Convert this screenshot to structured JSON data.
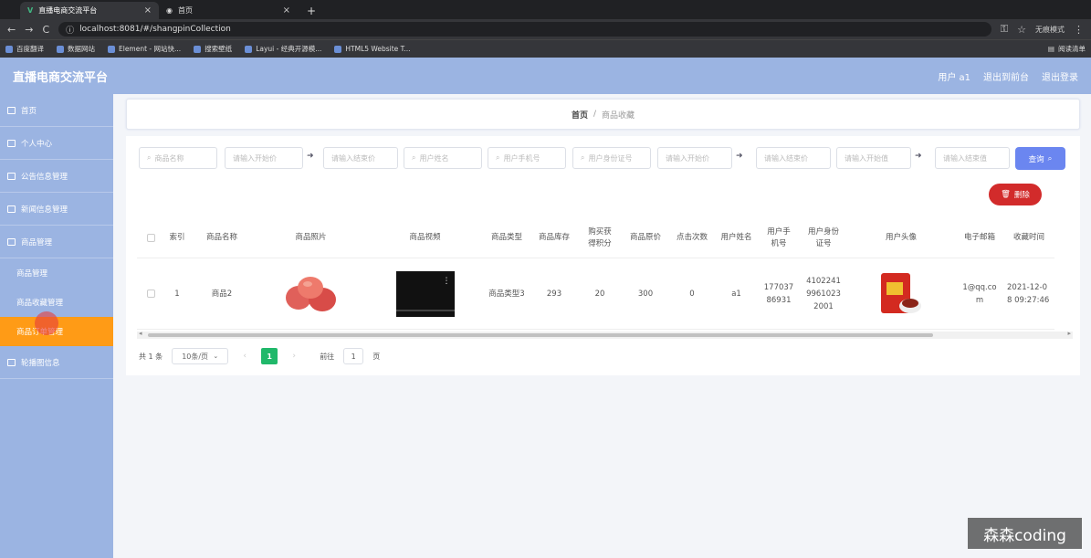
{
  "browser": {
    "tabs": [
      {
        "label": "直播电商交流平台"
      },
      {
        "label": "首页"
      }
    ],
    "url": "localhost:8081/#/shangpinCollection",
    "profile": "无痕模式",
    "reading_list": "阅读清单",
    "bookmarks": [
      "百度翻译",
      "数据网站",
      "Element - 网站快...",
      "搜索壁纸",
      "Layui - 经典开源模...",
      "HTML5 Website T..."
    ]
  },
  "header": {
    "brand": "直播电商交流平台",
    "user": "用户 a1",
    "back": "退出到前台",
    "logout": "退出登录"
  },
  "sidebar": {
    "items": [
      {
        "label": "首页"
      },
      {
        "label": "个人中心"
      },
      {
        "label": "公告信息管理"
      },
      {
        "label": "新闻信息管理"
      },
      {
        "label": "商品管理"
      }
    ],
    "subitems": [
      {
        "label": "商品管理"
      },
      {
        "label": "商品收藏管理"
      },
      {
        "label": "商品订单管理"
      }
    ],
    "extra": {
      "label": "轮播图信息"
    }
  },
  "breadcrumb": {
    "home": "首页",
    "sep": "/",
    "current": "商品收藏"
  },
  "filters": {
    "name": "商品名称",
    "start1": "请输入开始价",
    "end1": "请输入结束价",
    "username": "用户姓名",
    "phone": "用户手机号",
    "idcard": "用户身份证号",
    "start2": "请输入开始价",
    "end2": "请输入结束价",
    "start3": "请输入开始值",
    "end3": "请输入结束值",
    "query": "查询",
    "delete": "删除"
  },
  "table": {
    "headers": [
      "",
      "索引",
      "商品名称",
      "商品照片",
      "商品视频",
      "商品类型",
      "商品库存",
      "购买获得积分",
      "商品原价",
      "点击次数",
      "用户姓名",
      "用户手机号",
      "用户身份证号",
      "用户头像",
      "电子邮箱",
      "收藏时间"
    ],
    "row": {
      "index": "1",
      "name": "商品2",
      "type": "商品类型3",
      "stock": "293",
      "points": "20",
      "price": "300",
      "clicks": "0",
      "user": "a1",
      "phone": "17703786931",
      "idcard": "410224199610232001",
      "email": "1@qq.com",
      "time": "2021-12-08 09:27:46"
    }
  },
  "pagination": {
    "total": "共 1 条",
    "size": "10条/页",
    "page": "1",
    "goto": "前往",
    "goto_value": "1",
    "page_unit": "页"
  },
  "watermark": "森森coding"
}
